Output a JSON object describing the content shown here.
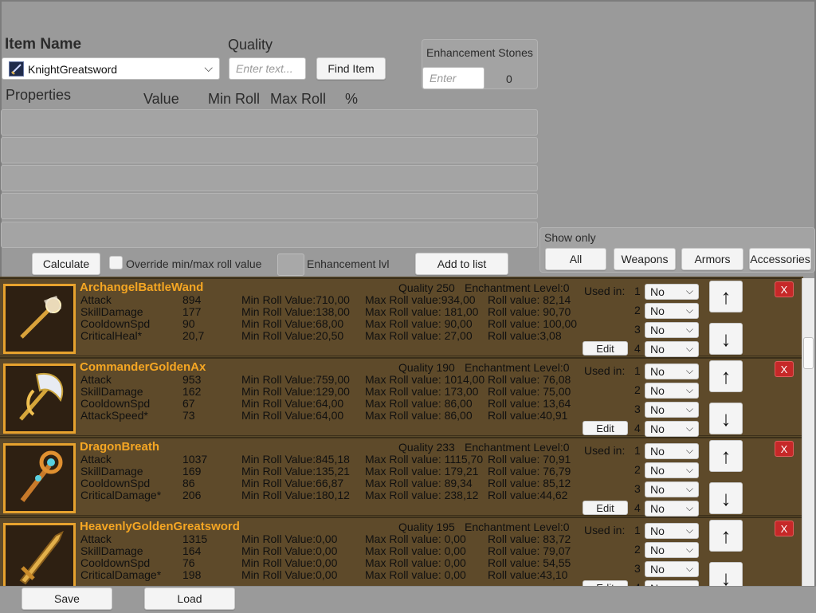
{
  "header": {
    "item_name_label": "Item Name",
    "item_select": {
      "value": "KnightGreatsword"
    },
    "quality_label": "Quality",
    "quality_placeholder": "Enter text...",
    "find_item_label": "Find Item",
    "enhancement_stones": {
      "label": "Enhancement Stones",
      "placeholder": "Enter",
      "value": "0"
    }
  },
  "properties": {
    "headers": [
      "Properties",
      "Value",
      "Min Roll",
      "Max Roll",
      "%"
    ]
  },
  "controls": {
    "calculate_label": "Calculate",
    "override_label": "Override min/max roll value",
    "enhancement_lvl_label": "Enhancement lvl",
    "add_to_list_label": "Add to list"
  },
  "filter": {
    "label": "Show only",
    "buttons": [
      "All",
      "Weapons",
      "Armors",
      "Accessories"
    ]
  },
  "list": {
    "used_in_label": "Used in:",
    "edit_label": "Edit",
    "remove_label": "X",
    "up_label": "↑",
    "down_label": "↓",
    "slot_numbers": [
      "1",
      "2",
      "3",
      "4"
    ],
    "items": [
      {
        "name": "ArchangelBattleWand",
        "quality": "Quality 250",
        "enchantment": "Enchantment Level:0",
        "icon": "wand-icon",
        "slots": [
          "No",
          "No",
          "No",
          "No"
        ],
        "stats": [
          [
            "Attack",
            "894",
            "Min Roll Value:710,00",
            "Max Roll value:934,00",
            "Roll value: 82,14"
          ],
          [
            "SkillDamage",
            "177",
            "Min Roll Value:138,00",
            "Max Roll value: 181,00",
            "Roll value: 90,70"
          ],
          [
            "CooldownSpd",
            "90",
            "Min Roll Value:68,00",
            "Max Roll value: 90,00",
            "Roll value: 100,00"
          ],
          [
            "CriticalHeal*",
            "20,7",
            "Min Roll Value:20,50",
            "Max Roll value: 27,00",
            "Roll value:3,08"
          ]
        ]
      },
      {
        "name": "CommanderGoldenAx",
        "quality": "Quality 190",
        "enchantment": "Enchantment Level:0",
        "icon": "axe-icon",
        "slots": [
          "No",
          "No",
          "No",
          "No"
        ],
        "stats": [
          [
            "Attack",
            "953",
            "Min Roll Value:759,00",
            "Max Roll value: 1014,00",
            "Roll value: 76,08"
          ],
          [
            "SkillDamage",
            "162",
            "Min Roll Value:129,00",
            "Max Roll value: 173,00",
            "Roll value: 75,00"
          ],
          [
            "CooldownSpd",
            "67",
            "Min Roll Value:64,00",
            "Max Roll value: 86,00",
            "Roll value: 13,64"
          ],
          [
            "AttackSpeed*",
            "73",
            "Min Roll Value:64,00",
            "Max Roll value: 86,00",
            "Roll value:40,91"
          ]
        ]
      },
      {
        "name": "DragonBreath",
        "quality": "Quality 233",
        "enchantment": "Enchantment Level:0",
        "icon": "staff-icon",
        "slots": [
          "No",
          "No",
          "No",
          "No"
        ],
        "stats": [
          [
            "Attack",
            "1037",
            "Min Roll Value:845,18",
            "Max Roll value: 1115,70",
            "Roll value: 70,91"
          ],
          [
            "SkillDamage",
            "169",
            "Min Roll Value:135,21",
            "Max Roll value: 179,21",
            "Roll value: 76,79"
          ],
          [
            "CooldownSpd",
            "86",
            "Min Roll Value:66,87",
            "Max Roll value: 89,34",
            "Roll value: 85,12"
          ],
          [
            "CriticalDamage*",
            "206",
            "Min Roll Value:180,12",
            "Max Roll value: 238,12",
            "Roll value:44,62"
          ]
        ]
      },
      {
        "name": "HeavenlyGoldenGreatsword",
        "quality": "Quality 195",
        "enchantment": "Enchantment Level:0",
        "icon": "greatsword-icon",
        "slots": [
          "No",
          "No",
          "No",
          "No"
        ],
        "stats": [
          [
            "Attack",
            "1315",
            "Min Roll Value:0,00",
            "Max Roll value: 0,00",
            "Roll value: 83,72"
          ],
          [
            "SkillDamage",
            "164",
            "Min Roll Value:0,00",
            "Max Roll value: 0,00",
            "Roll value: 79,07"
          ],
          [
            "CooldownSpd",
            "76",
            "Min Roll Value:0,00",
            "Max Roll value: 0,00",
            "Roll value: 54,55"
          ],
          [
            "CriticalDamage*",
            "198",
            "Min Roll Value:0,00",
            "Max Roll value: 0,00",
            "Roll value:43,10"
          ]
        ]
      }
    ]
  },
  "footer": {
    "save_label": "Save",
    "load_label": "Load"
  },
  "colors": {
    "item_name": "#f5a623",
    "item_bg": "#5e4a2a",
    "thumb_border": "#e7a22e",
    "remove_button": "#c62828"
  }
}
